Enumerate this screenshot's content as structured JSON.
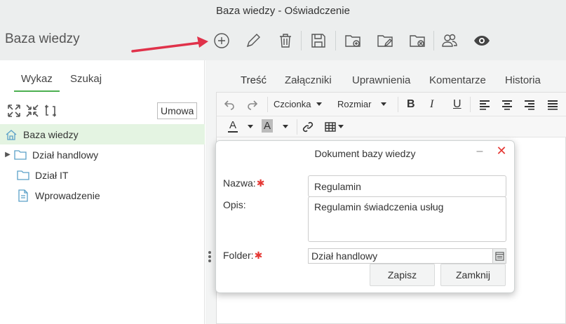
{
  "window": {
    "title": "Baza wiedzy - Oświadczenie"
  },
  "header": {
    "app_title": "Baza wiedzy",
    "toolbar": [
      "add-icon",
      "edit-icon",
      "delete-icon",
      "save-icon",
      "folder-add-icon",
      "folder-edit-icon",
      "folder-delete-icon",
      "users-icon",
      "eye-icon"
    ]
  },
  "left_panel": {
    "tabs": [
      {
        "label": "Wykaz",
        "active": true
      },
      {
        "label": "Szukaj",
        "active": false
      }
    ],
    "filter_value": "Umowa",
    "tree": [
      {
        "label": "Baza wiedzy",
        "icon": "home-icon",
        "selected": true
      },
      {
        "label": "Dział handlowy",
        "icon": "folder-icon",
        "expandable": true
      },
      {
        "label": "Dział IT",
        "icon": "folder-icon"
      },
      {
        "label": "Wprowadzenie",
        "icon": "document-icon"
      }
    ]
  },
  "right_panel": {
    "tabs": [
      {
        "label": "Treść",
        "active": true
      },
      {
        "label": "Załączniki"
      },
      {
        "label": "Uprawnienia"
      },
      {
        "label": "Komentarze"
      },
      {
        "label": "Historia"
      }
    ],
    "editor_toolbar": {
      "font_label": "Czcionka",
      "size_label": "Rozmiar",
      "bold": "B",
      "italic": "I",
      "underline": "U",
      "font_color": "A",
      "bg_color": "A"
    }
  },
  "dialog": {
    "title": "Dokument bazy wiedzy",
    "name_label": "Nazwa:",
    "name_value": "Regulamin",
    "desc_label": "Opis:",
    "desc_value": "Regulamin świadczenia usług",
    "folder_label": "Folder:",
    "folder_value": "Dział handlowy",
    "save_label": "Zapisz",
    "close_label": "Zamknij"
  },
  "colors": {
    "accent": "#4caf50",
    "required": "#e53935",
    "arrow": "#e0324a"
  }
}
